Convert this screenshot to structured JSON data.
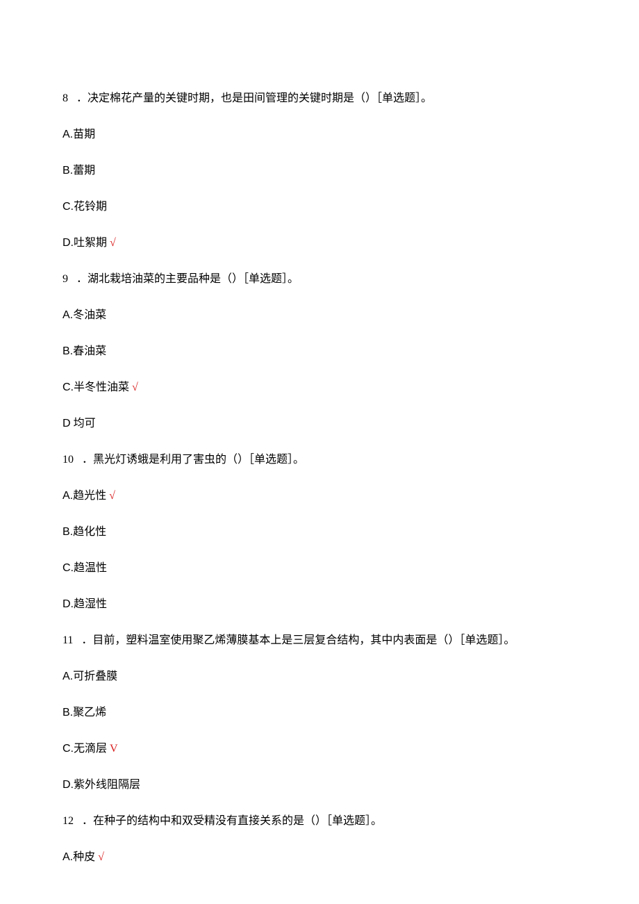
{
  "questions": [
    {
      "number": "8",
      "text": "．决定棉花产量的关键时期，也是田间管理的关键时期是（）［单选题］。",
      "options": [
        {
          "label": "A.",
          "text": "苗期",
          "correct": false
        },
        {
          "label": "B.",
          "text": "蕾期",
          "correct": false
        },
        {
          "label": "C.",
          "text": "花铃期",
          "correct": false
        },
        {
          "label": "D.",
          "text": "吐絮期",
          "correct": true,
          "mark": "√"
        }
      ]
    },
    {
      "number": "9",
      "text": "．湖北栽培油菜的主要品种是（）［单选题］。",
      "options": [
        {
          "label": "A.",
          "text": "冬油菜",
          "correct": false
        },
        {
          "label": "B.",
          "text": "春油菜",
          "correct": false
        },
        {
          "label": "C.",
          "text": "半冬性油菜",
          "correct": true,
          "mark": "√"
        },
        {
          "label": "D",
          "text": " 均可",
          "correct": false
        }
      ]
    },
    {
      "number": "10",
      "text": "．黑光灯诱蛾是利用了害虫的（）［单选题］。",
      "options": [
        {
          "label": "A.",
          "text": "趋光性",
          "correct": true,
          "mark": "√"
        },
        {
          "label": "B.",
          "text": "趋化性",
          "correct": false
        },
        {
          "label": "C.",
          "text": "趋温性",
          "correct": false
        },
        {
          "label": "D.",
          "text": "趋湿性",
          "correct": false
        }
      ]
    },
    {
      "number": "11",
      "text": "．目前，塑料温室使用聚乙烯薄膜基本上是三层复合结构，其中内表面是（）［单选题］。",
      "options": [
        {
          "label": "A.",
          "text": "可折叠膜",
          "correct": false
        },
        {
          "label": "B.",
          "text": "聚乙烯",
          "correct": false
        },
        {
          "label": "C.",
          "text": "无滴层",
          "correct": true,
          "mark": "V"
        },
        {
          "label": "D.",
          "text": "紫外线阻隔层",
          "correct": false
        }
      ]
    },
    {
      "number": "12",
      "text": "．在种子的结构中和双受精没有直接关系的是（）［单选题］。",
      "options": [
        {
          "label": "A.",
          "text": "种皮",
          "correct": true,
          "mark": "√"
        }
      ]
    }
  ]
}
